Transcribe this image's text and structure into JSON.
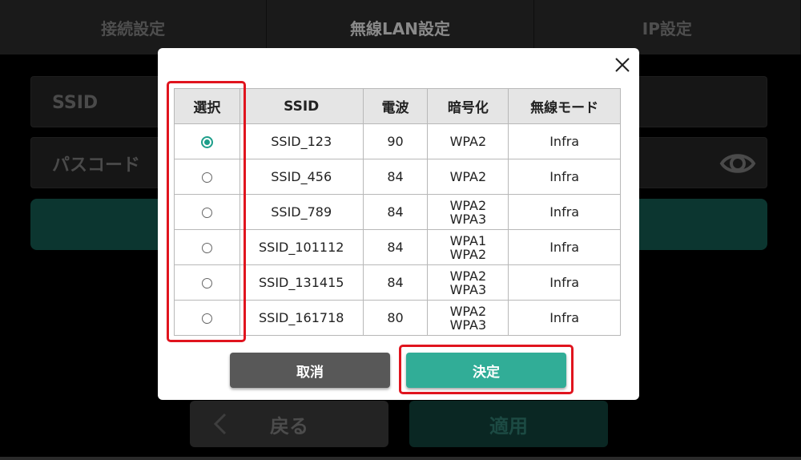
{
  "tabs": [
    {
      "label": "接続設定"
    },
    {
      "label": "無線LAN設定"
    },
    {
      "label": "IP設定"
    }
  ],
  "form": {
    "ssid_label": "SSID",
    "passcode_label": "パスコード"
  },
  "footer": {
    "back_label": "戻る",
    "apply_label": "適用"
  },
  "dialog": {
    "columns": [
      "選択",
      "SSID",
      "電波",
      "暗号化",
      "無線モード"
    ],
    "rows": [
      {
        "selected": true,
        "ssid": "SSID_123",
        "signal": "90",
        "enc1": "WPA2",
        "enc2": "",
        "mode": "Infra"
      },
      {
        "selected": false,
        "ssid": "SSID_456",
        "signal": "84",
        "enc1": "WPA2",
        "enc2": "",
        "mode": "Infra"
      },
      {
        "selected": false,
        "ssid": "SSID_789",
        "signal": "84",
        "enc1": "WPA2",
        "enc2": "WPA3",
        "mode": "Infra"
      },
      {
        "selected": false,
        "ssid": "SSID_101112",
        "signal": "84",
        "enc1": "WPA1",
        "enc2": "WPA2",
        "mode": "Infra"
      },
      {
        "selected": false,
        "ssid": "SSID_131415",
        "signal": "84",
        "enc1": "WPA2",
        "enc2": "WPA3",
        "mode": "Infra"
      },
      {
        "selected": false,
        "ssid": "SSID_161718",
        "signal": "80",
        "enc1": "WPA2",
        "enc2": "WPA3",
        "mode": "Infra"
      }
    ],
    "cancel_label": "取消",
    "confirm_label": "決定"
  },
  "colors": {
    "accent": "#31ad97",
    "cancel": "#585858",
    "highlight": "#e0141e"
  }
}
